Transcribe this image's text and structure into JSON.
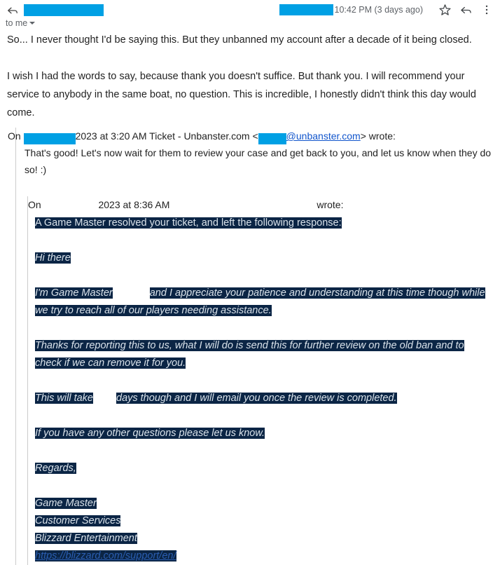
{
  "header": {
    "back_icon": "reply-arrow-icon",
    "sender_redacted": true,
    "to_line": "to me",
    "timestamp": "10:42 PM (3 days ago)",
    "star_icon": "star-icon",
    "reply_icon": "reply-arrow-icon",
    "more_icon": "more-vertical-icon"
  },
  "body": {
    "paragraph_1": "So... I never thought I'd be saying this. But they unbanned my account after a decade of it being closed.",
    "paragraph_2": "I wish I had the words to say, because thank you doesn't suffice. But thank you. I will recommend your service to anybody in the same boat, no question. This is incredible, I honestly didn't think this day would come."
  },
  "quote_level_1": {
    "attr_prefix": "On",
    "attr_year_time": "2023 at 3:20 AM Ticket - Unbanster.com <",
    "attr_email_link": "@unbanster.com",
    "attr_suffix": "> wrote:",
    "text": "That's good! Let's now wait for them to review your case and get back to you, and let us know when they do so! :)"
  },
  "quote_level_2": {
    "attr_prefix": "On",
    "attr_year_time": "2023 at 8:36 AM",
    "attr_suffix": "wrote:",
    "lines": {
      "intro": "A Game Master resolved your ticket, and left the following response:",
      "greeting": "Hi there",
      "para_1": "I'm Game Master",
      "para_1_cont": "and I appreciate your patience and understanding at this time though while we try to reach all of our players needing assistance.",
      "para_2": "Thanks for reporting this to us, what I will do is send this for further review on the old ban and to check if we can remove it for you.",
      "para_3_a": "This will take",
      "para_3_b": "days though and I will email you once the review is completed.",
      "para_4": "If you have any other questions please let us know.",
      "regards": "Regards,",
      "sig_1": "Game Master",
      "sig_2": "Customer Services",
      "sig_3": "Blizzard Entertainment",
      "sig_link": "https://blizzard.com/support/en/"
    }
  },
  "colors": {
    "redaction": "#00a0e4",
    "highlight_bg": "#0b2545",
    "highlight_text": "#d9e2ea",
    "link": "#1155cc",
    "highlight_link": "#2a5db0",
    "quote_border": "#cccccc"
  }
}
